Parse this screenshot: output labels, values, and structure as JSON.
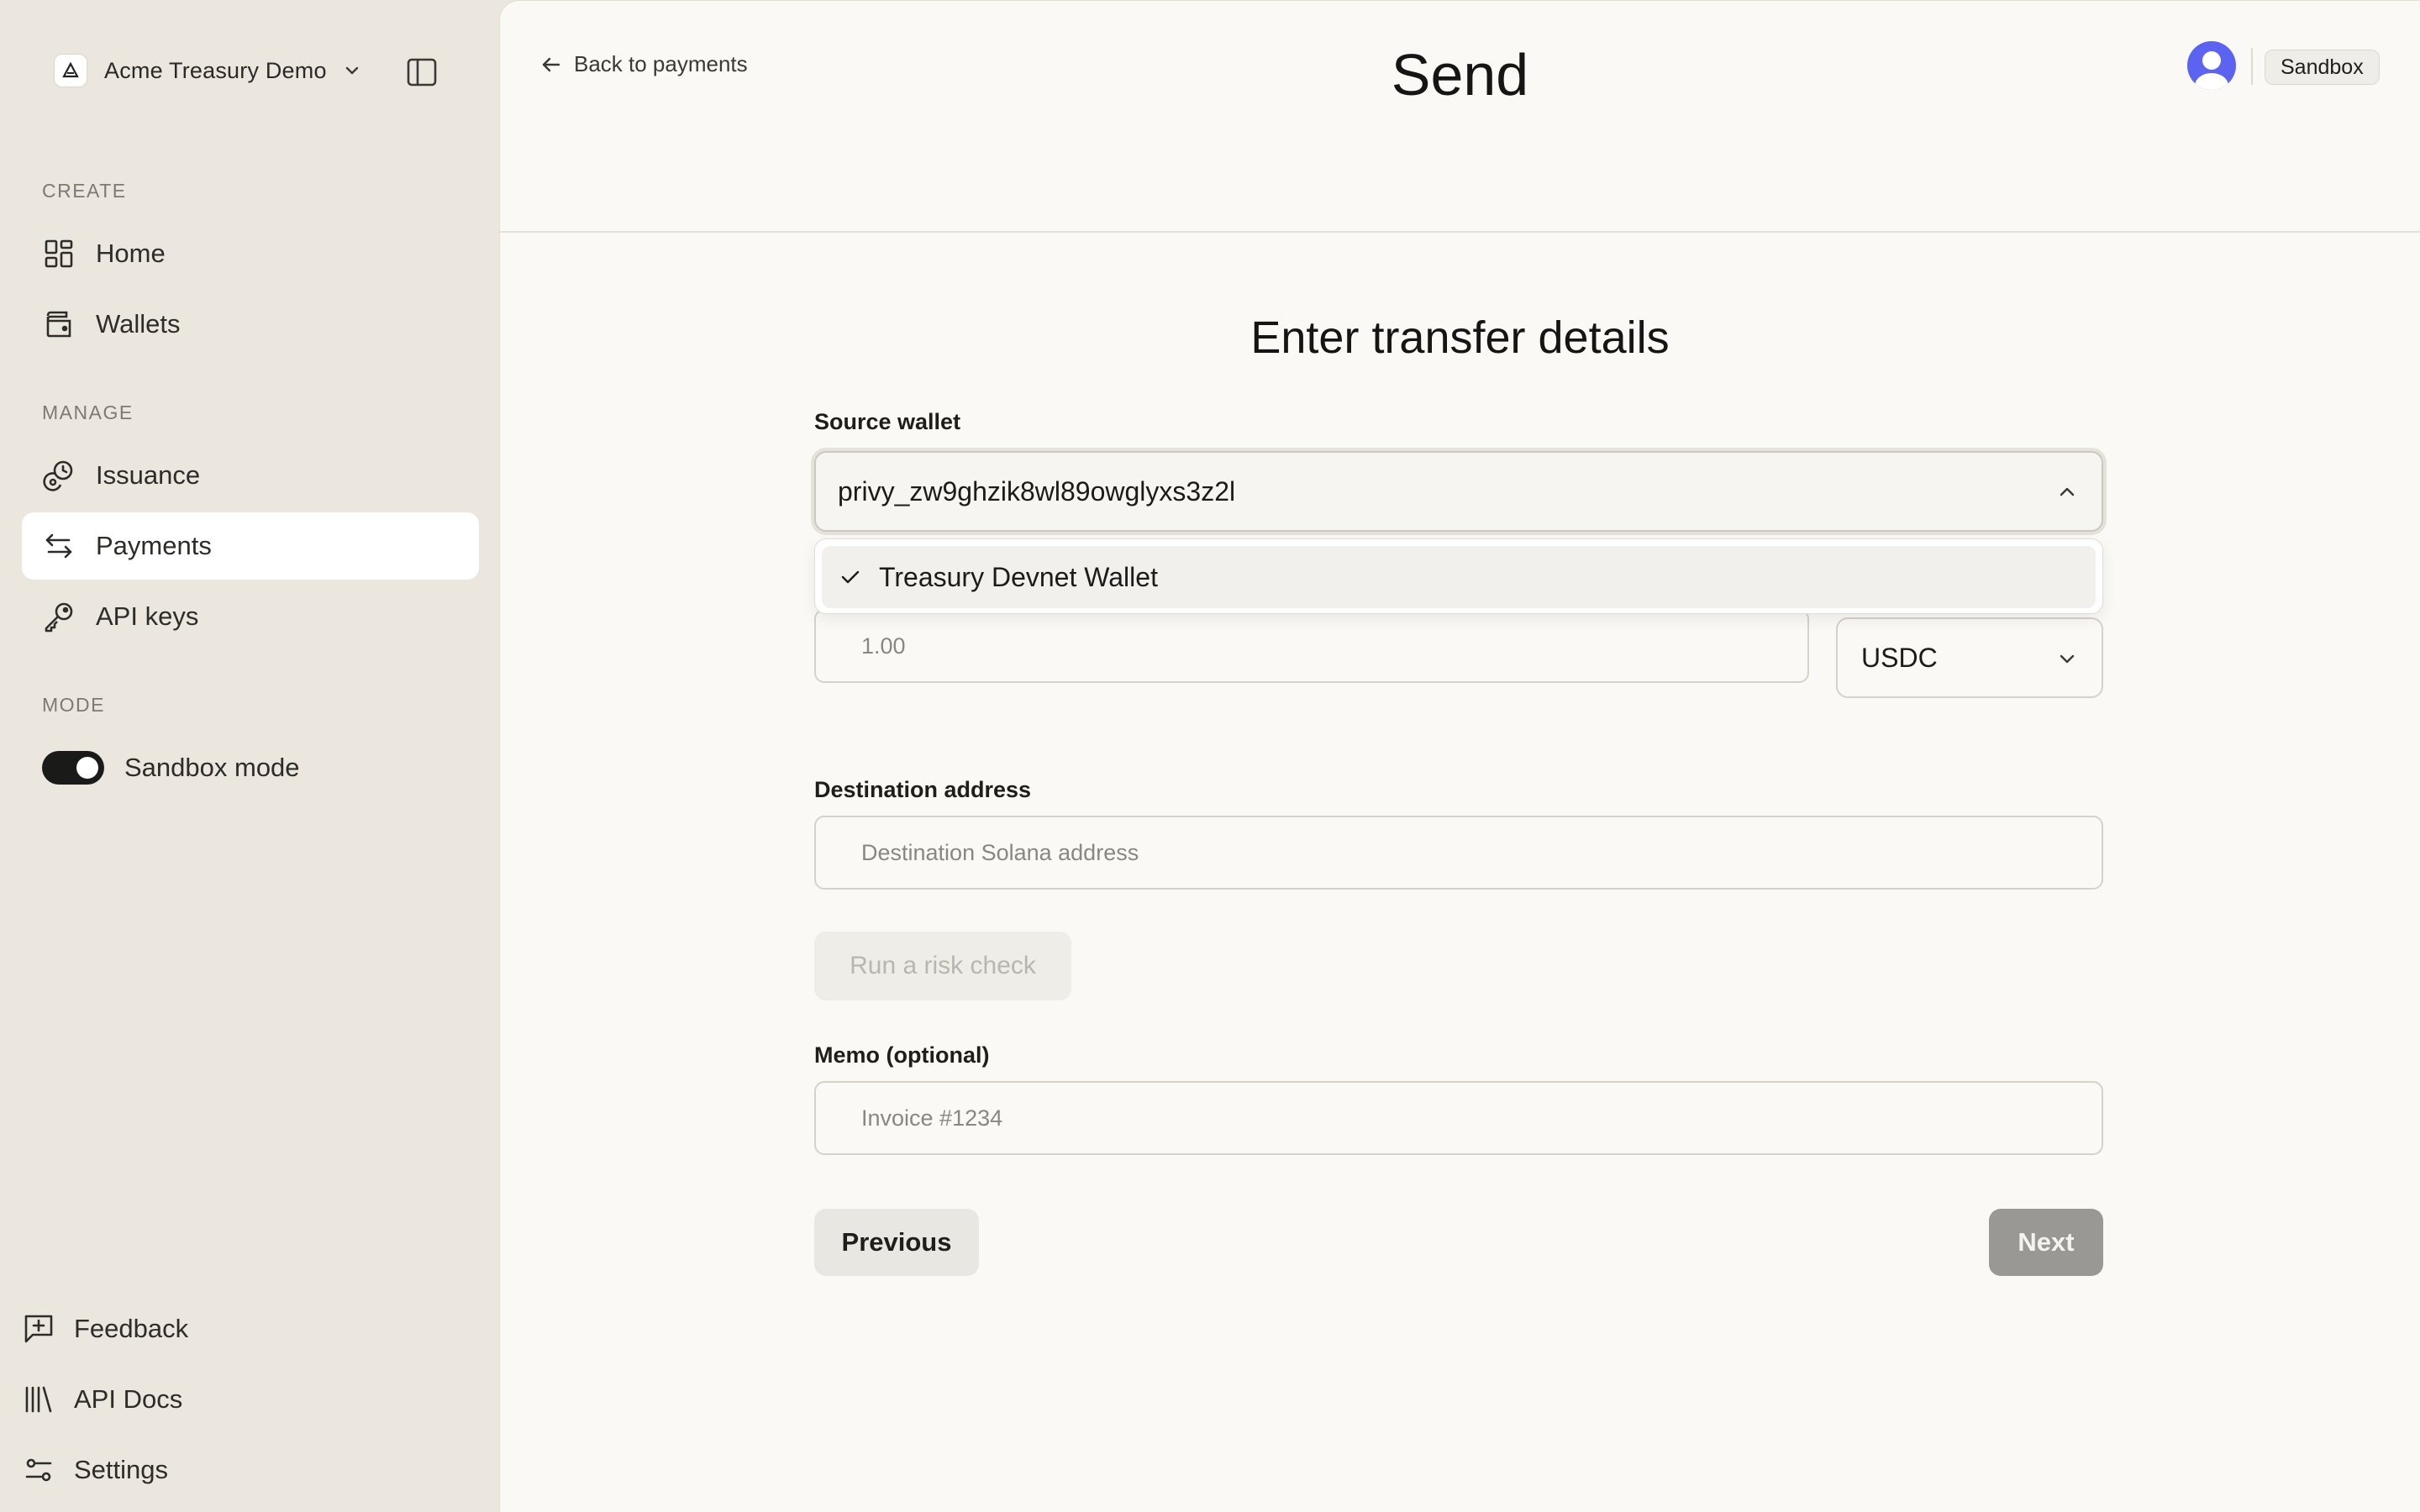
{
  "sidebar": {
    "org_name": "Acme Treasury Demo",
    "sections": {
      "create": "CREATE",
      "manage": "MANAGE",
      "mode": "MODE"
    },
    "items": [
      {
        "label": "Home",
        "icon": "grid-icon"
      },
      {
        "label": "Wallets",
        "icon": "wallet-icon"
      },
      {
        "label": "Issuance",
        "icon": "coins-icon"
      },
      {
        "label": "Payments",
        "icon": "arrows-swap-icon",
        "active": true
      },
      {
        "label": "API keys",
        "icon": "key-icon"
      }
    ],
    "mode_toggle": {
      "label": "Sandbox mode",
      "on": true
    },
    "footer": [
      {
        "label": "Feedback",
        "icon": "feedback-icon"
      },
      {
        "label": "API Docs",
        "icon": "library-icon"
      },
      {
        "label": "Settings",
        "icon": "sliders-icon"
      }
    ]
  },
  "header": {
    "back_label": "Back to payments",
    "title": "Send",
    "env_badge": "Sandbox"
  },
  "form": {
    "title": "Enter transfer details",
    "source_wallet": {
      "label": "Source wallet",
      "value": "privy_zw9ghzik8wl89owglyxs3z2l",
      "options": [
        "Treasury Devnet Wallet"
      ],
      "selected_option": "Treasury Devnet Wallet"
    },
    "amount": {
      "placeholder": "1.00"
    },
    "currency": {
      "value": "USDC"
    },
    "destination": {
      "label": "Destination address",
      "placeholder": "Destination Solana address"
    },
    "risk_check_label": "Run a risk check",
    "memo": {
      "label": "Memo (optional)",
      "placeholder": "Invoice #1234"
    },
    "previous_label": "Previous",
    "next_label": "Next"
  },
  "colors": {
    "sidebar_bg": "#ebe7df",
    "main_bg": "#faf9f6",
    "avatar": "#5b63f0",
    "next_disabled": "#9a9894"
  }
}
